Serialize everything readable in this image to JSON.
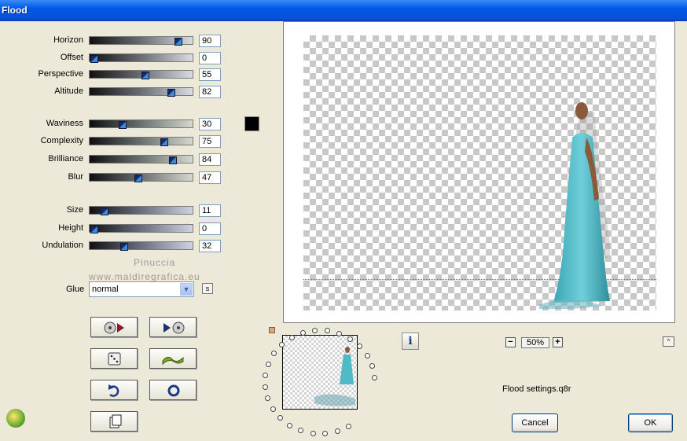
{
  "window": {
    "title": "Flood"
  },
  "sliders_group1": [
    {
      "label": "Horizon",
      "value": "90",
      "fraction": 0.9
    },
    {
      "label": "Offset",
      "value": "0",
      "fraction": 0.0
    },
    {
      "label": "Perspective",
      "value": "55",
      "fraction": 0.55
    },
    {
      "label": "Altitude",
      "value": "82",
      "fraction": 0.82
    }
  ],
  "sliders_group2": [
    {
      "label": "Waviness",
      "value": "30",
      "fraction": 0.3
    },
    {
      "label": "Complexity",
      "value": "75",
      "fraction": 0.75
    },
    {
      "label": "Brilliance",
      "value": "84",
      "fraction": 0.84
    },
    {
      "label": "Blur",
      "value": "47",
      "fraction": 0.47
    }
  ],
  "sliders_group3": [
    {
      "label": "Size",
      "value": "11",
      "fraction": 0.11
    },
    {
      "label": "Height",
      "value": "0",
      "fraction": 0.0
    },
    {
      "label": "Undulation",
      "value": "32",
      "fraction": 0.32
    }
  ],
  "color_swatch": "#000000",
  "glue": {
    "label": "Glue",
    "value": "normal",
    "reset_label": "s"
  },
  "watermark": {
    "line1": "Pinuccia",
    "line2": "www.maldiregrafica.eu"
  },
  "tool_buttons": [
    {
      "name": "preset-previous-button",
      "icon": "disc-arrow-right-icon"
    },
    {
      "name": "preset-next-button",
      "icon": "arrow-disc-icon"
    },
    {
      "name": "randomize-button",
      "icon": "dice-icon"
    },
    {
      "name": "wave-preview-button",
      "icon": "wave-icon"
    },
    {
      "name": "undo-button",
      "icon": "undo-arrow-icon"
    },
    {
      "name": "reset-button",
      "icon": "ring-icon"
    },
    {
      "name": "copy-button",
      "icon": "pages-icon"
    }
  ],
  "info_label": "i",
  "zoom": {
    "value": "50%",
    "minus": "−",
    "plus": "+"
  },
  "collapse_label": "^",
  "settings_file": "Flood settings.q8r",
  "buttons": {
    "cancel": "Cancel",
    "ok": "OK"
  },
  "colors": {
    "titlebar": "#0a50d8",
    "dress": "#4fb9c6",
    "accent": "#3d8ad8"
  }
}
